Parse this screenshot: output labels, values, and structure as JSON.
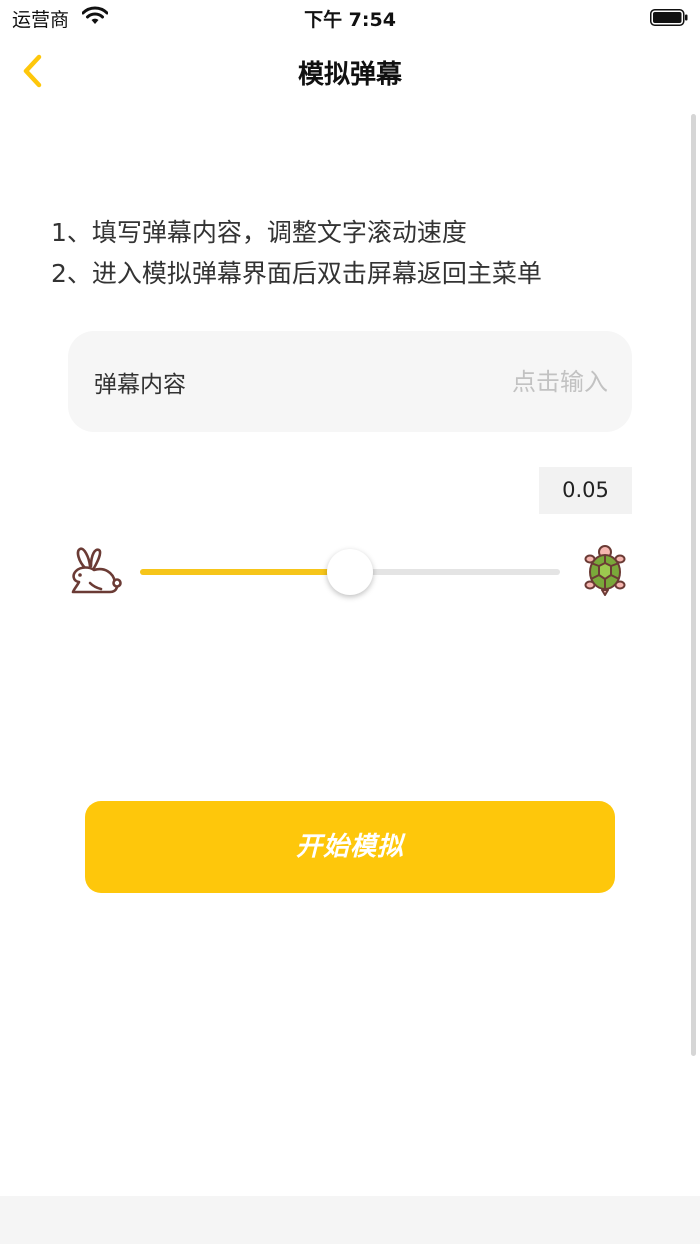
{
  "status_bar": {
    "carrier": "运营商",
    "time": "下午 7:54"
  },
  "nav": {
    "title": "模拟弹幕"
  },
  "instructions": [
    "1、填写弹幕内容，调整文字滚动速度",
    "2、进入模拟弹幕界面后双击屏幕返回主菜单"
  ],
  "content_field": {
    "label": "弹幕内容",
    "placeholder": "点击输入",
    "value": ""
  },
  "speed": {
    "value": "0.05",
    "slider_fraction": 0.5
  },
  "colors": {
    "accent": "#fec70b",
    "slider_fill": "#f6c51a"
  },
  "icons": {
    "back": "chevron-left-icon",
    "slow": "rabbit-icon",
    "fast": "turtle-icon"
  },
  "actions": {
    "start_label": "开始模拟"
  }
}
